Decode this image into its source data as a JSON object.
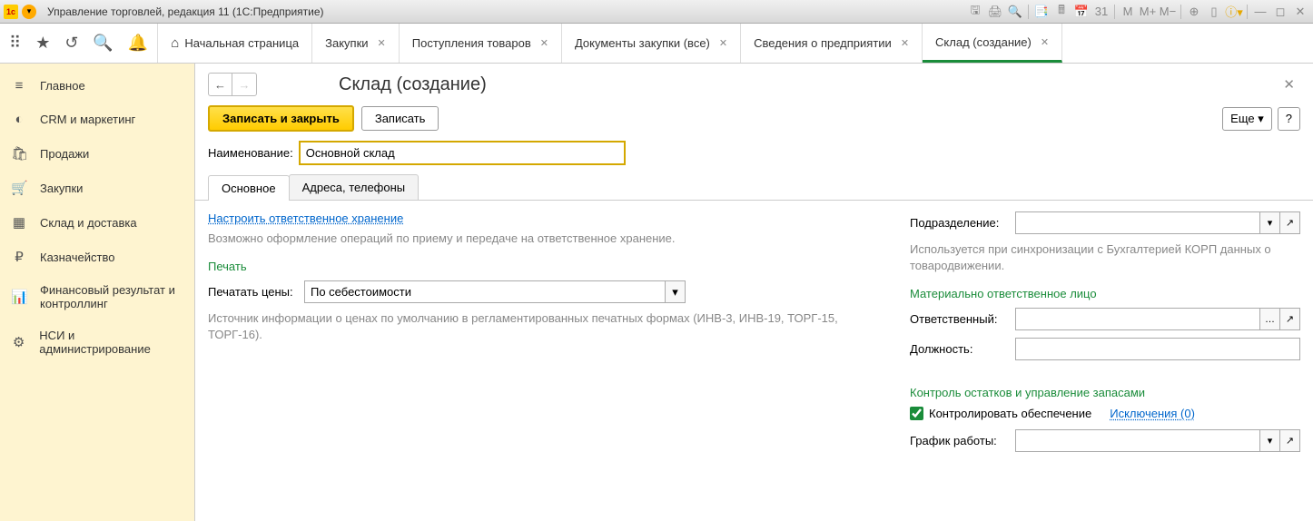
{
  "titlebar": {
    "title": "Управление торговлей, редакция 11 (1С:Предприятие)"
  },
  "topTabs": {
    "home": "Начальная страница",
    "t1": "Закупки",
    "t2": "Поступления товаров",
    "t3": "Документы закупки (все)",
    "t4": "Сведения о предприятии",
    "t5": "Склад (создание)"
  },
  "sidebar": {
    "i0": "Главное",
    "i1": "CRM и маркетинг",
    "i2": "Продажи",
    "i3": "Закупки",
    "i4": "Склад и доставка",
    "i5": "Казначейство",
    "i6": "Финансовый результат и контроллинг",
    "i7": "НСИ и администрирование"
  },
  "content": {
    "title": "Склад (создание)",
    "saveClose": "Записать и закрыть",
    "save": "Записать",
    "more": "Еще",
    "help": "?",
    "nameLabel": "Наименование:",
    "nameValue": "Основной склад",
    "tab1": "Основное",
    "tab2": "Адреса, телефоны",
    "configLink": "Настроить ответственное хранение",
    "configHint": "Возможно оформление операций по приему и передаче на ответственное хранение.",
    "printSection": "Печать",
    "printPricesLabel": "Печатать цены:",
    "printPricesValue": "По себестоимости",
    "priceSourceHint": "Источник информации о ценах по умолчанию в регламентированных печатных формах (ИНВ-3, ИНВ-19, ТОРГ-15, ТОРГ-16).",
    "divisionLabel": "Подразделение:",
    "divisionHint": "Используется при синхронизации с Бухгалтерией КОРП данных о товародвижении.",
    "molSection": "Материально ответственное лицо",
    "responsibleLabel": "Ответственный:",
    "positionLabel": "Должность:",
    "controlSection": "Контроль остатков и управление запасами",
    "controlCheck": "Контролировать обеспечение",
    "exceptionsLink": "Исключения (0)",
    "scheduleLabel": "График работы:"
  }
}
